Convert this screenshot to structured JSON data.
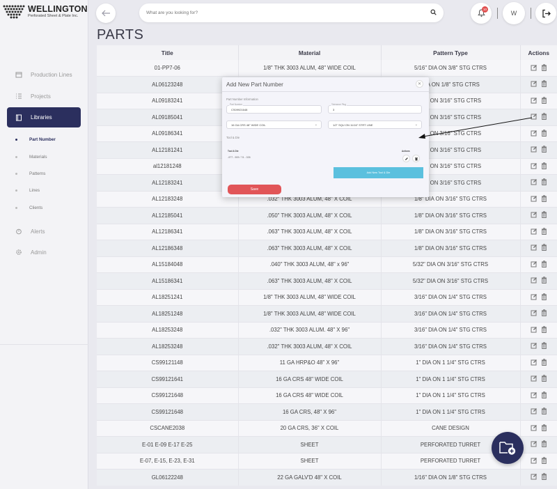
{
  "brand": {
    "name": "WELLINGTON",
    "tagline": "Perforated Sheet & Plate Inc."
  },
  "sidebar": {
    "items": [
      {
        "label": "Production Lines",
        "icon": "calendar-icon"
      },
      {
        "label": "Projects",
        "icon": "list-icon"
      },
      {
        "label": "Libraries",
        "icon": "book-icon",
        "active": true
      },
      {
        "label": "Alerts",
        "icon": "alarm-icon"
      },
      {
        "label": "Admin",
        "icon": "gear-icon"
      }
    ],
    "subitems": [
      {
        "label": "Part Number",
        "active": true
      },
      {
        "label": "Materials"
      },
      {
        "label": "Patterns"
      },
      {
        "label": "Lines"
      },
      {
        "label": "Clients"
      }
    ]
  },
  "topbar": {
    "search_placeholder": "What are you looking for?",
    "notification_count": "10",
    "user_initial": "W"
  },
  "page": {
    "title": "PARTS"
  },
  "table": {
    "headers": {
      "title": "Title",
      "material": "Material",
      "pattern": "Pattern Type",
      "actions": "Actions"
    },
    "rows": [
      [
        "01-PP7-06",
        "1/8\" THK 3003 ALUM, 48\" WIDE COIL",
        "5/16\" DIA ON 3/8\" STG CTRS"
      ],
      [
        "AL06123248",
        "",
        "DIA ON 1/8\" STG CTRS"
      ],
      [
        "AL09183241",
        "",
        "DIA ON 3/16\" STG CTRS"
      ],
      [
        "AL09185041",
        "",
        "DIA ON 3/16\" STG CTRS"
      ],
      [
        "AL09186341",
        "",
        "DIA ON 3/16\" STG CTRS"
      ],
      [
        "AL12181241",
        "",
        "DIA ON 3/16\" STG CTRS"
      ],
      [
        "al12181248",
        "",
        "DIA ON 3/16\" STG CTRS"
      ],
      [
        "AL12183241",
        "",
        "DIA ON 3/16\" STG CTRS"
      ],
      [
        "AL12183248",
        ".032\" THK 3003 ALUM, 48\" X COIL",
        "1/8\" DIA ON 3/16\" STG CTRS"
      ],
      [
        "AL12185041",
        ".050\" THK 3003 ALUM, 48\" X COIL",
        "1/8\" DIA ON 3/16\" STG CTRS"
      ],
      [
        "AL12186341",
        ".063\" THK 3003 ALUM, 48\" X COIL",
        "1/8\" DIA ON 3/16\" STG CTRS"
      ],
      [
        "AL12186348",
        ".063\" THK 3003 ALUM, 48\" X COIL",
        "1/8\" DIA ON 3/16\" STG CTRS"
      ],
      [
        "AL15184048",
        ".040\" THK 3003 ALUM, 48\" x 96\"",
        "5/32\" DIA ON 3/16\" STG CTRS"
      ],
      [
        "AL15186341",
        ".063\" THK 3003 ALUM, 48\" X COIL",
        "5/32\" DIA ON 3/16\" STG CTRS"
      ],
      [
        "AL18251241",
        "1/8\" THK 3003 ALUM, 48\" WIDE COIL",
        "3/16\" DIA ON 1/4\" STG CTRS"
      ],
      [
        "AL18251248",
        "1/8\" THK 3003 ALUM, 48\" WIDE COIL",
        "3/16\" DIA ON 1/4\" STG CTRS"
      ],
      [
        "AL18253248",
        ".032\" THK 3003 ALUM. 48\" X 96\"",
        "3/16\" DIA ON 1/4\" STG CTRS"
      ],
      [
        "AL18253248",
        ".032\" THK 3003 ALUM, 48\" X COIL",
        "3/16\" DIA ON 1/4\" STG CTRS"
      ],
      [
        "CS99121148",
        "11 GA HRP&O 48\" X 96\"",
        "1\" DIA ON 1 1/4\" STG CTRS"
      ],
      [
        "CS99121641",
        "16 GA CRS 48\" WIDE COIL",
        "1\" DIA ON 1 1/4\" STG CTRS"
      ],
      [
        "CS99121648",
        "16 GA CRS 48\" WIDE COIL",
        "1\" DIA ON 1 1/4\" STG CTRS"
      ],
      [
        "CS99121648",
        "16 GA CRS, 48\" X 96\"",
        "1\" DIA ON 1 1/4\" STG CTRS"
      ],
      [
        "CSCANE2038",
        "20 GA CRS, 36\" X COIL",
        "CANE DESIGN"
      ],
      [
        "E-01 E-09 E-17 E-25",
        "SHEET",
        "PERFORATED TURRET"
      ],
      [
        "E-07, E-15, E-23, E-31",
        "SHEET",
        "PERFORATED TURRET"
      ],
      [
        "GL06122248",
        "22 GA GALV'D 48\" X COIL",
        "1/16\" DIA ON 1/8\" STG CTRS"
      ]
    ]
  },
  "modal": {
    "title": "Add New Part Number",
    "section_info": "Part Number Information",
    "part_label": "Part Number",
    "part_value": "CS09921648",
    "second_label": "Tolerance Plug",
    "second_value": "3",
    "material_value": "16 GA CRS 48\" WIDE COIL",
    "pattern_value": "1/2\" SQU ON 11/16\" STRT LINE",
    "section_tool": "Tool & Die",
    "tool_header": "Tool & Die",
    "actions_header": "Actions",
    "tool_value": "-977 - 909 / 74 - 026",
    "add_tool_label": "Add New Tool & Die",
    "save_label": "Save"
  }
}
